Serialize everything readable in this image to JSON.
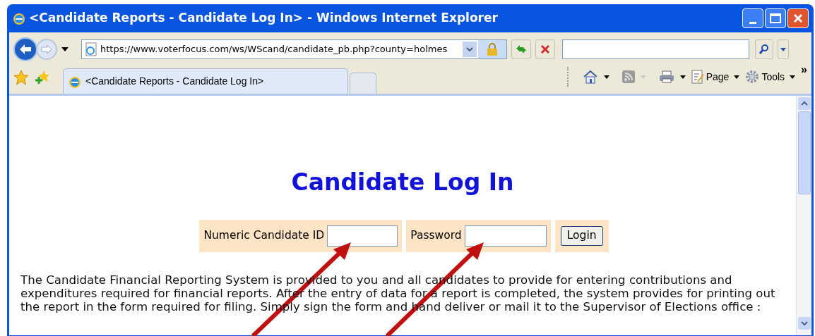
{
  "window": {
    "title": "<Candidate Reports - Candidate Log In> - Windows Internet Explorer"
  },
  "address_bar": {
    "url": "https://www.voterfocus.com/ws/WScand/candidate_pb.php?county=holmes"
  },
  "tabs": [
    {
      "title": "<Candidate Reports - Candidate Log In>",
      "selected": true
    }
  ],
  "command_bar": {
    "page": "Page",
    "tools": "Tools",
    "more": "»"
  },
  "page": {
    "heading": "Candidate Log In",
    "fields": [
      {
        "label": "Numeric Candidate ID",
        "kind": "text"
      },
      {
        "label": "Password",
        "kind": "password"
      }
    ],
    "button": "Login",
    "paragraph": "The Candidate Financial Reporting System is provided to you and all candidates to provide for entering contributions and expenditures required for financial reports. After the entry of data for a report is completed, the system provides for printing out the report in the form required for filing. Simply sign the form and hand deliver or mail it to the Supervisor of Elections office :"
  }
}
